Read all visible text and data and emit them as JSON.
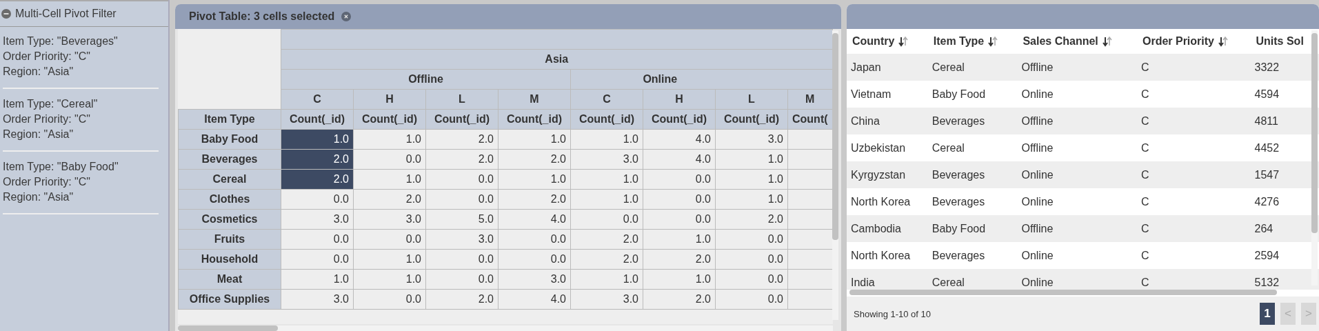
{
  "filter_panel": {
    "title": "Multi-Cell Pivot Filter",
    "expanded": true,
    "filters": [
      {
        "lines": [
          "Item Type: \"Beverages\"",
          "Order Priority: \"C\"",
          "Region: \"Asia\""
        ]
      },
      {
        "lines": [
          "Item Type: \"Cereal\"",
          "Order Priority: \"C\"",
          "Region: \"Asia\""
        ]
      },
      {
        "lines": [
          "Item Type: \"Baby Food\"",
          "Order Priority: \"C\"",
          "Region: \"Asia\""
        ]
      }
    ]
  },
  "pivot": {
    "title": "Pivot Table: 3 cells selected",
    "region": "Asia",
    "channels": [
      "Offline",
      "Online"
    ],
    "priorities": [
      "C",
      "H",
      "L",
      "M",
      "C",
      "H",
      "L",
      "M"
    ],
    "measures": [
      "Count(_id)",
      "Count(_id)",
      "Count(_id)",
      "Count(_id)",
      "Count(_id)",
      "Count(_id)",
      "Count(_id)",
      "Count("
    ],
    "row_header": "Item Type",
    "rows": [
      {
        "label": "Baby Food",
        "cells": [
          {
            "value": "1.0",
            "selected": true
          },
          {
            "value": "1.0",
            "selected": false
          },
          {
            "value": "2.0",
            "selected": false
          },
          {
            "value": "1.0",
            "selected": false
          },
          {
            "value": "1.0",
            "selected": false
          },
          {
            "value": "4.0",
            "selected": false
          },
          {
            "value": "3.0",
            "selected": false
          }
        ]
      },
      {
        "label": "Beverages",
        "cells": [
          {
            "value": "2.0",
            "selected": true
          },
          {
            "value": "0.0",
            "selected": false
          },
          {
            "value": "2.0",
            "selected": false
          },
          {
            "value": "2.0",
            "selected": false
          },
          {
            "value": "3.0",
            "selected": false
          },
          {
            "value": "4.0",
            "selected": false
          },
          {
            "value": "1.0",
            "selected": false
          }
        ]
      },
      {
        "label": "Cereal",
        "cells": [
          {
            "value": "2.0",
            "selected": true
          },
          {
            "value": "1.0",
            "selected": false
          },
          {
            "value": "0.0",
            "selected": false
          },
          {
            "value": "1.0",
            "selected": false
          },
          {
            "value": "1.0",
            "selected": false
          },
          {
            "value": "0.0",
            "selected": false
          },
          {
            "value": "1.0",
            "selected": false
          }
        ]
      },
      {
        "label": "Clothes",
        "cells": [
          {
            "value": "0.0",
            "selected": false
          },
          {
            "value": "2.0",
            "selected": false
          },
          {
            "value": "0.0",
            "selected": false
          },
          {
            "value": "2.0",
            "selected": false
          },
          {
            "value": "1.0",
            "selected": false
          },
          {
            "value": "0.0",
            "selected": false
          },
          {
            "value": "1.0",
            "selected": false
          }
        ]
      },
      {
        "label": "Cosmetics",
        "cells": [
          {
            "value": "3.0",
            "selected": false
          },
          {
            "value": "3.0",
            "selected": false
          },
          {
            "value": "5.0",
            "selected": false
          },
          {
            "value": "4.0",
            "selected": false
          },
          {
            "value": "0.0",
            "selected": false
          },
          {
            "value": "0.0",
            "selected": false
          },
          {
            "value": "2.0",
            "selected": false
          }
        ]
      },
      {
        "label": "Fruits",
        "cells": [
          {
            "value": "0.0",
            "selected": false
          },
          {
            "value": "0.0",
            "selected": false
          },
          {
            "value": "3.0",
            "selected": false
          },
          {
            "value": "0.0",
            "selected": false
          },
          {
            "value": "2.0",
            "selected": false
          },
          {
            "value": "1.0",
            "selected": false
          },
          {
            "value": "0.0",
            "selected": false
          }
        ]
      },
      {
        "label": "Household",
        "cells": [
          {
            "value": "0.0",
            "selected": false
          },
          {
            "value": "1.0",
            "selected": false
          },
          {
            "value": "0.0",
            "selected": false
          },
          {
            "value": "0.0",
            "selected": false
          },
          {
            "value": "2.0",
            "selected": false
          },
          {
            "value": "2.0",
            "selected": false
          },
          {
            "value": "0.0",
            "selected": false
          }
        ]
      },
      {
        "label": "Meat",
        "cells": [
          {
            "value": "1.0",
            "selected": false
          },
          {
            "value": "1.0",
            "selected": false
          },
          {
            "value": "0.0",
            "selected": false
          },
          {
            "value": "3.0",
            "selected": false
          },
          {
            "value": "1.0",
            "selected": false
          },
          {
            "value": "1.0",
            "selected": false
          },
          {
            "value": "0.0",
            "selected": false
          }
        ]
      },
      {
        "label": "Office Supplies",
        "cells": [
          {
            "value": "3.0",
            "selected": false
          },
          {
            "value": "0.0",
            "selected": false
          },
          {
            "value": "2.0",
            "selected": false
          },
          {
            "value": "4.0",
            "selected": false
          },
          {
            "value": "3.0",
            "selected": false
          },
          {
            "value": "2.0",
            "selected": false
          },
          {
            "value": "0.0",
            "selected": false
          }
        ]
      }
    ]
  },
  "records": {
    "columns": [
      "Country",
      "Item Type",
      "Sales Channel",
      "Order Priority",
      "Units Sol"
    ],
    "rows": [
      [
        "Japan",
        "Cereal",
        "Offline",
        "C",
        "3322"
      ],
      [
        "Vietnam",
        "Baby Food",
        "Online",
        "C",
        "4594"
      ],
      [
        "China",
        "Beverages",
        "Offline",
        "C",
        "4811"
      ],
      [
        "Uzbekistan",
        "Cereal",
        "Offline",
        "C",
        "4452"
      ],
      [
        "Kyrgyzstan",
        "Beverages",
        "Online",
        "C",
        "1547"
      ],
      [
        "North Korea",
        "Beverages",
        "Online",
        "C",
        "4276"
      ],
      [
        "Cambodia",
        "Baby Food",
        "Offline",
        "C",
        "264"
      ],
      [
        "North Korea",
        "Beverages",
        "Online",
        "C",
        "2594"
      ],
      [
        "India",
        "Cereal",
        "Online",
        "C",
        "5132"
      ]
    ],
    "footer": "Showing 1-10 of 10",
    "pages": [
      {
        "label": "1",
        "selected": true
      },
      {
        "label": "<",
        "selected": false
      },
      {
        "label": ">",
        "selected": false
      }
    ]
  }
}
